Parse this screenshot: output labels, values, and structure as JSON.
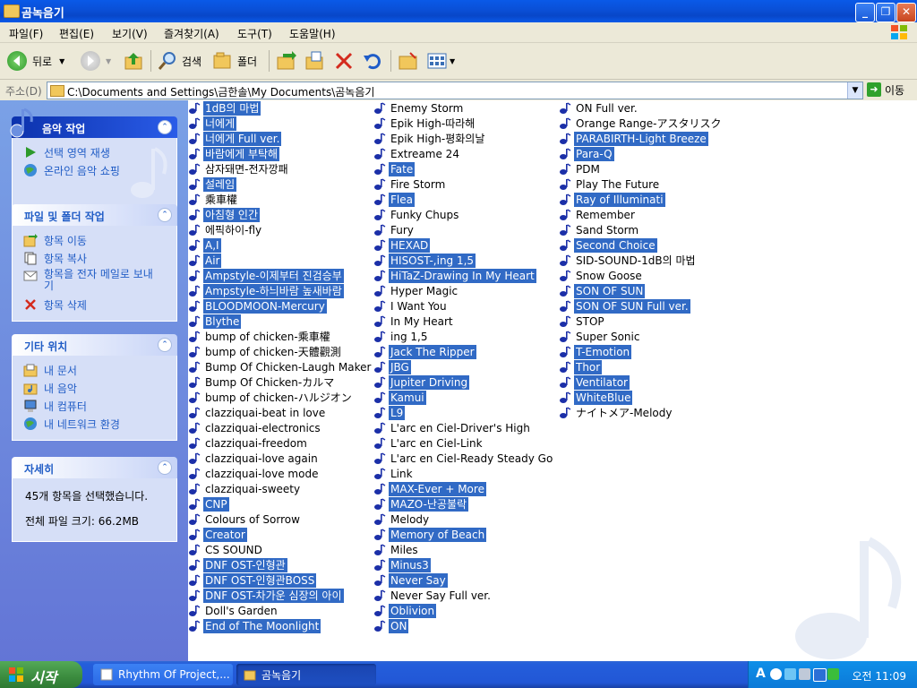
{
  "window": {
    "title": "곰녹음기"
  },
  "menu": [
    "파일(F)",
    "편집(E)",
    "보기(V)",
    "즐겨찾기(A)",
    "도구(T)",
    "도움말(H)"
  ],
  "toolbar": {
    "back": "뒤로",
    "search": "검색",
    "folders": "폴더"
  },
  "address": {
    "label": "주소(D)",
    "path": "C:\\Documents and Settings\\금한솔\\My Documents\\곰녹음기",
    "go": "이동"
  },
  "tasks": {
    "music": {
      "title": "음악 작업",
      "items": [
        "선택 영역 재생",
        "온라인 음악 쇼핑"
      ]
    },
    "file": {
      "title": "파일 및 폴더 작업",
      "items": [
        "항목 이동",
        "항목 복사",
        "항목을 전자 메일로 보내기",
        "항목 삭제"
      ]
    },
    "other": {
      "title": "기타 위치",
      "items": [
        "내 문서",
        "내 음악",
        "내 컴퓨터",
        "내 네트워크 환경"
      ]
    },
    "details": {
      "title": "자세히",
      "selected": "45개 항목을 선택했습니다.",
      "size": "전체 파일 크기: 66.2MB"
    }
  },
  "files": [
    [
      {
        "name": "1dB의 마법",
        "sel": true
      },
      {
        "name": "너에게",
        "sel": true
      },
      {
        "name": "너에게 Full ver.",
        "sel": true
      },
      {
        "name": "바람에게 부탁해",
        "sel": true
      },
      {
        "name": "삼자돼면-전자깡패",
        "sel": false
      },
      {
        "name": "설레임",
        "sel": true
      },
      {
        "name": "乘車權",
        "sel": false
      },
      {
        "name": "아침형 인간",
        "sel": true
      },
      {
        "name": "에픽하이-fly",
        "sel": false
      },
      {
        "name": "A,I",
        "sel": true
      },
      {
        "name": "Air",
        "sel": true
      },
      {
        "name": "Ampstyle-이제부터 진검승부",
        "sel": true
      },
      {
        "name": "Ampstyle-하늬바람 높새바람",
        "sel": true
      },
      {
        "name": "BLOODMOON-Mercury",
        "sel": true
      },
      {
        "name": "Blythe",
        "sel": true
      },
      {
        "name": "bump of chicken-乘車權",
        "sel": false
      },
      {
        "name": "bump of chicken-天體觀測",
        "sel": false
      },
      {
        "name": "Bump Of Chicken-Laugh Maker",
        "sel": false
      },
      {
        "name": "Bump Of Chicken-カルマ",
        "sel": false
      },
      {
        "name": "bump of chicken-ハルジオン",
        "sel": false
      },
      {
        "name": "clazziquai-beat in love",
        "sel": false
      },
      {
        "name": "clazziquai-electronics",
        "sel": false
      },
      {
        "name": "clazziquai-freedom",
        "sel": false
      },
      {
        "name": "clazziquai-love again",
        "sel": false
      },
      {
        "name": "clazziquai-love mode",
        "sel": false
      },
      {
        "name": "clazziquai-sweety",
        "sel": false
      },
      {
        "name": "CNP",
        "sel": true
      },
      {
        "name": "Colours of Sorrow",
        "sel": false
      },
      {
        "name": "Creator",
        "sel": true
      },
      {
        "name": "CS SOUND",
        "sel": false
      },
      {
        "name": "DNF OST-인형관",
        "sel": true
      },
      {
        "name": "DNF OST-인형관BOSS",
        "sel": true
      },
      {
        "name": "DNF OST-차가운 심장의 아이",
        "sel": true
      },
      {
        "name": "Doll's Garden",
        "sel": false
      },
      {
        "name": "End of The Moonlight",
        "sel": true
      }
    ],
    [
      {
        "name": "Enemy Storm",
        "sel": false
      },
      {
        "name": "Epik High-따라해",
        "sel": false
      },
      {
        "name": "Epik High-평화의날",
        "sel": false
      },
      {
        "name": "Extreame 24",
        "sel": false
      },
      {
        "name": "Fate",
        "sel": true
      },
      {
        "name": "Fire Storm",
        "sel": false
      },
      {
        "name": "Flea",
        "sel": true
      },
      {
        "name": "Funky Chups",
        "sel": false
      },
      {
        "name": "Fury",
        "sel": false
      },
      {
        "name": "HEXAD",
        "sel": true
      },
      {
        "name": "HISOST-,ing 1,5",
        "sel": true
      },
      {
        "name": "HiTaZ-Drawing In My Heart",
        "sel": true
      },
      {
        "name": "Hyper Magic",
        "sel": false
      },
      {
        "name": "I Want You",
        "sel": false
      },
      {
        "name": "In My Heart",
        "sel": false
      },
      {
        "name": "ing 1,5",
        "sel": false
      },
      {
        "name": "Jack The Ripper",
        "sel": true
      },
      {
        "name": "JBG",
        "sel": true
      },
      {
        "name": "Jupiter Driving",
        "sel": true
      },
      {
        "name": "Kamui",
        "sel": true
      },
      {
        "name": "L9",
        "sel": true
      },
      {
        "name": "L'arc en Ciel-Driver's High",
        "sel": false
      },
      {
        "name": "L'arc en Ciel-Link",
        "sel": false
      },
      {
        "name": "L'arc en Ciel-Ready Steady Go",
        "sel": false
      },
      {
        "name": "Link",
        "sel": false
      },
      {
        "name": "MAX-Ever + More",
        "sel": true
      },
      {
        "name": "MAZO-난공불락",
        "sel": true
      },
      {
        "name": "Melody",
        "sel": false
      },
      {
        "name": "Memory of Beach",
        "sel": true
      },
      {
        "name": "Miles",
        "sel": false
      },
      {
        "name": "Minus3",
        "sel": true
      },
      {
        "name": "Never Say",
        "sel": true
      },
      {
        "name": "Never Say Full ver.",
        "sel": false
      },
      {
        "name": "Oblivion",
        "sel": true
      },
      {
        "name": "ON",
        "sel": true
      }
    ],
    [
      {
        "name": "ON Full ver.",
        "sel": false
      },
      {
        "name": "Orange Range-アスタリスク",
        "sel": false
      },
      {
        "name": "PARABIRTH-Light Breeze",
        "sel": true
      },
      {
        "name": "Para-Q",
        "sel": true
      },
      {
        "name": "PDM",
        "sel": false
      },
      {
        "name": "Play The Future",
        "sel": false
      },
      {
        "name": "Ray of Illuminati",
        "sel": true
      },
      {
        "name": "Remember",
        "sel": false
      },
      {
        "name": "Sand Storm",
        "sel": false
      },
      {
        "name": "Second Choice",
        "sel": true
      },
      {
        "name": "SID-SOUND-1dB의 마법",
        "sel": false
      },
      {
        "name": "Snow Goose",
        "sel": false
      },
      {
        "name": "SON OF SUN",
        "sel": true
      },
      {
        "name": "SON OF SUN Full ver.",
        "sel": true
      },
      {
        "name": "STOP",
        "sel": false
      },
      {
        "name": "Super Sonic",
        "sel": false
      },
      {
        "name": "T-Emotion",
        "sel": true
      },
      {
        "name": "Thor",
        "sel": true
      },
      {
        "name": "Ventilator",
        "sel": true
      },
      {
        "name": "WhiteBlue",
        "sel": true
      },
      {
        "name": "ナイトメア-Melody",
        "sel": false
      }
    ]
  ],
  "taskbar": {
    "start": "시작",
    "tasks": [
      "Rhythm Of Project,...",
      "곰녹음기"
    ],
    "clock": "오전 11:09"
  },
  "colors": {
    "selection": "#316ac5",
    "taskpane": "#6375d6",
    "titlebar": "#0a4fd6"
  }
}
